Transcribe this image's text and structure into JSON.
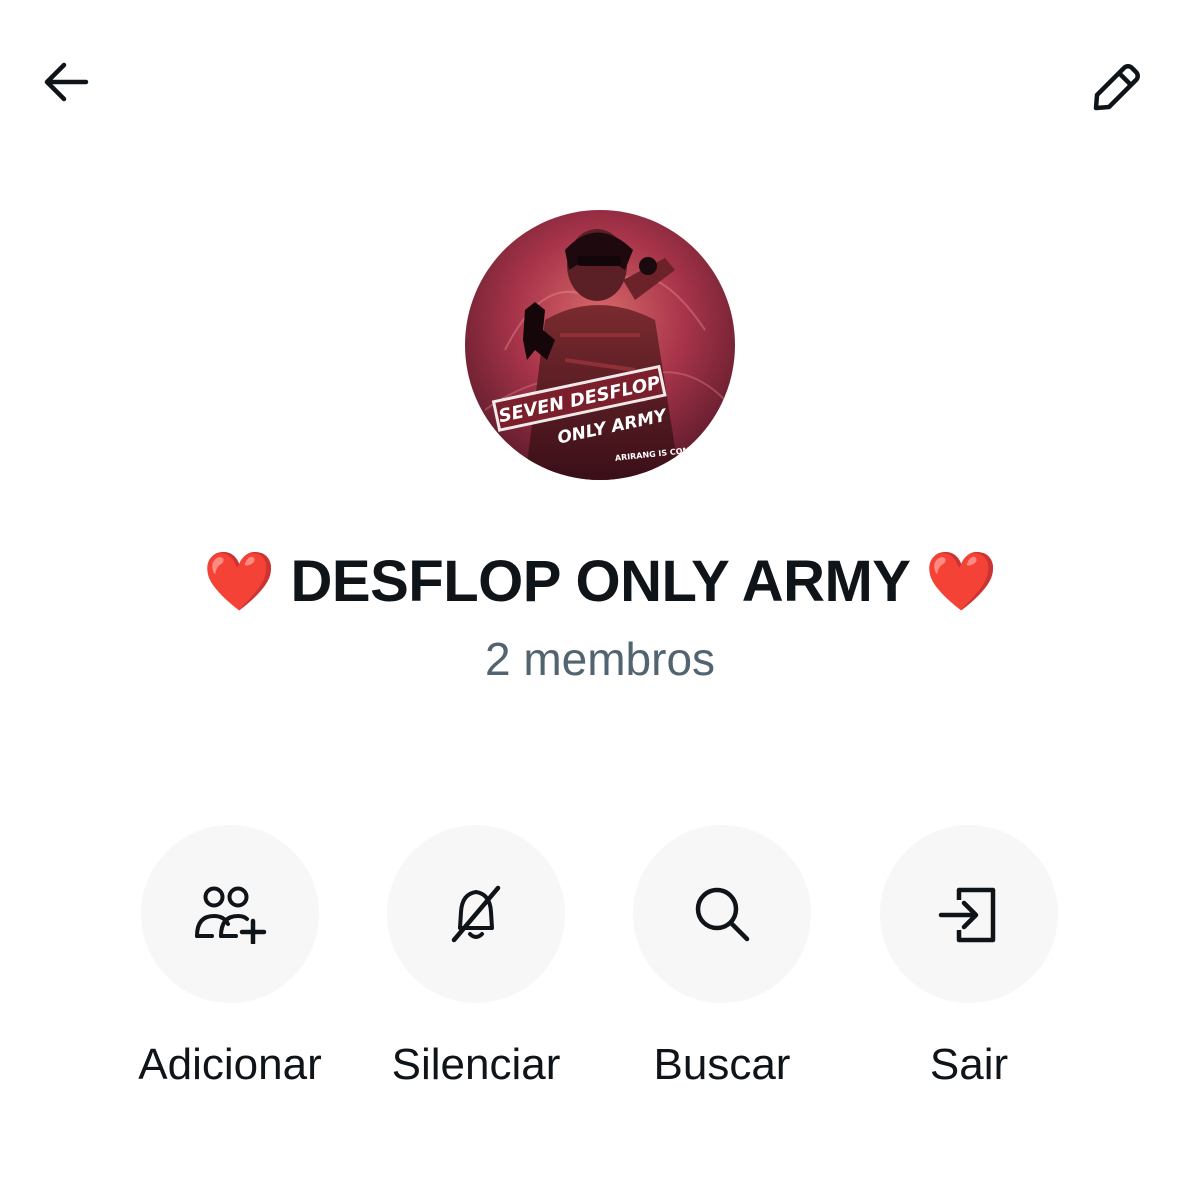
{
  "header": {
    "back_icon": "arrow-left-icon",
    "edit_icon": "pencil-icon"
  },
  "group": {
    "name": "❤️ DESFLOP ONLY ARMY ❤️",
    "members": "2 membros",
    "avatar": {
      "line1": "SEVEN DESFLOP",
      "line2": "ONLY ARMY",
      "line3": "ARIRANG IS COMING"
    }
  },
  "actions": [
    {
      "label": "Adicionar",
      "icon": "add-people-icon"
    },
    {
      "label": "Silenciar",
      "icon": "bell-off-icon"
    },
    {
      "label": "Buscar",
      "icon": "search-icon"
    },
    {
      "label": "Sair",
      "icon": "exit-icon"
    }
  ],
  "colors": {
    "text_primary": "#0f1419",
    "text_secondary": "#536471",
    "action_bg": "#f7f7f8"
  }
}
